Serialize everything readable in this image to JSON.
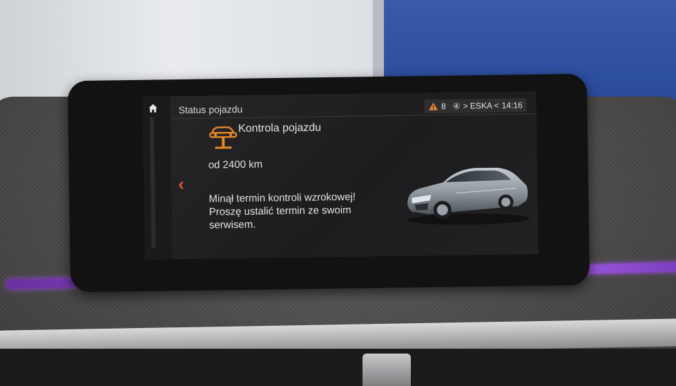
{
  "header": {
    "title": "Status pojazdu",
    "warning_count": "8",
    "radio_preset": "④",
    "radio_station": "> ESKA <",
    "clock": "14:16"
  },
  "check": {
    "title": "Kontrola pojazdu",
    "distance": "od 2400 km",
    "message_lines": [
      "Minął termin kontroli wzrokowej!",
      "Proszę ustalić termin ze swoim",
      "serwisem."
    ]
  },
  "icons": {
    "home": "home-icon",
    "back": "chevron-left-icon",
    "warning": "warning-triangle-icon",
    "service": "car-lift-icon"
  },
  "colors": {
    "accent_orange": "#e8862a",
    "back_chevron": "#e2572a",
    "text": "#e4e4e4",
    "ambient_light": "#9b4fe0"
  }
}
